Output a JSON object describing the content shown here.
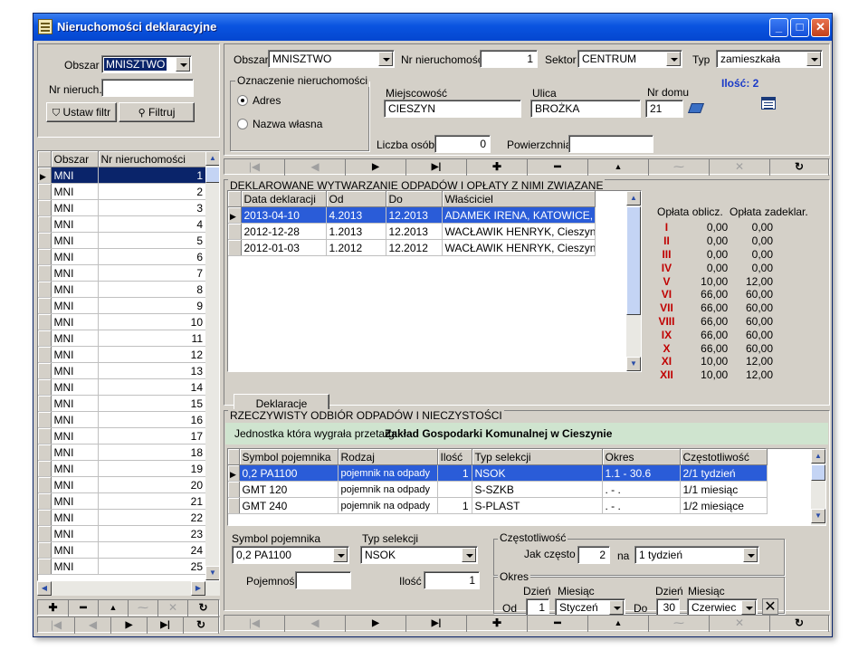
{
  "window": {
    "title": "Nieruchomości deklaracyjne"
  },
  "left": {
    "obszar_label": "Obszar",
    "obszar_value": "MNISZTWO",
    "nr_nieruch_label": "Nr nieruch.",
    "nr_nieruch_value": "",
    "btn_ustaw": "Ustaw filtr",
    "btn_filtruj": "Filtruj",
    "columns": [
      "Obszar",
      "Nr nieruchomości"
    ],
    "rows": [
      [
        "MNI",
        "1"
      ],
      [
        "MNI",
        "2"
      ],
      [
        "MNI",
        "3"
      ],
      [
        "MNI",
        "4"
      ],
      [
        "MNI",
        "5"
      ],
      [
        "MNI",
        "6"
      ],
      [
        "MNI",
        "7"
      ],
      [
        "MNI",
        "8"
      ],
      [
        "MNI",
        "9"
      ],
      [
        "MNI",
        "10"
      ],
      [
        "MNI",
        "11"
      ],
      [
        "MNI",
        "12"
      ],
      [
        "MNI",
        "13"
      ],
      [
        "MNI",
        "14"
      ],
      [
        "MNI",
        "15"
      ],
      [
        "MNI",
        "16"
      ],
      [
        "MNI",
        "17"
      ],
      [
        "MNI",
        "18"
      ],
      [
        "MNI",
        "19"
      ],
      [
        "MNI",
        "20"
      ],
      [
        "MNI",
        "21"
      ],
      [
        "MNI",
        "22"
      ],
      [
        "MNI",
        "23"
      ],
      [
        "MNI",
        "24"
      ],
      [
        "MNI",
        "25"
      ]
    ]
  },
  "header": {
    "obszar_label": "Obszar",
    "obszar_value": "MNISZTWO",
    "nr_label": "Nr nieruchomości",
    "nr_value": "1",
    "sektor_label": "Sektor",
    "sektor_value": "CENTRUM",
    "typ_label": "Typ",
    "typ_value": "zamieszkała",
    "ozn_title": "Oznaczenie nieruchomości",
    "radio_adres": "Adres",
    "radio_nazwa": "Nazwa własna",
    "miejscowosc_label": "Miejscowość",
    "miejscowosc_value": "CIESZYN",
    "ulica_label": "Ulica",
    "ulica_value": "BROŻKA",
    "nrdomu_label": "Nr domu",
    "nrdomu_value": "21",
    "ilosc": "Ilość: 2",
    "liczba_osob_label": "Liczba osób",
    "liczba_osob_value": "0",
    "powierzchnia_label": "Powierzchnia",
    "powierzchnia_value": ""
  },
  "nav_icons": [
    "first",
    "prev",
    "next",
    "last",
    "add",
    "delete",
    "up",
    "edit",
    "cancel",
    "refresh"
  ],
  "declarations": {
    "title": "DEKLAROWANE WYTWARZANIE ODPADÓW I OPŁATY Z NIMI ZWIĄZANE",
    "columns": [
      "Data deklaracji",
      "Od",
      "Do",
      "Właściciel"
    ],
    "rows": [
      [
        "2013-04-10",
        "4.2013",
        "12.2013",
        "ADAMEK IRENA, KATOWICE, ul. B"
      ],
      [
        "2012-12-28",
        "1.2013",
        "12.2013",
        "WACŁAWIK HENRYK, Cieszyn, ul."
      ],
      [
        "2012-01-03",
        "1.2012",
        "12.2012",
        "WACŁAWIK HENRYK, Cieszyn, ul."
      ]
    ],
    "btn_deklaracje": "Deklaracje",
    "fee_col1": "Opłata oblicz.",
    "fee_col2": "Opłata zadeklar.",
    "fees": [
      [
        "I",
        "0,00",
        "0,00"
      ],
      [
        "II",
        "0,00",
        "0,00"
      ],
      [
        "III",
        "0,00",
        "0,00"
      ],
      [
        "IV",
        "0,00",
        "0,00"
      ],
      [
        "V",
        "10,00",
        "12,00"
      ],
      [
        "VI",
        "66,00",
        "60,00"
      ],
      [
        "VII",
        "66,00",
        "60,00"
      ],
      [
        "VIII",
        "66,00",
        "60,00"
      ],
      [
        "IX",
        "66,00",
        "60,00"
      ],
      [
        "X",
        "66,00",
        "60,00"
      ],
      [
        "XI",
        "10,00",
        "12,00"
      ],
      [
        "XII",
        "10,00",
        "12,00"
      ]
    ]
  },
  "collection": {
    "title": "RZECZYWISTY ODBIÓR ODPADÓW I NIECZYSTOŚCI",
    "winner_label": "Jednostka która wygrała przetarg:",
    "winner_value": "Zakład Gospodarki Komunalnej w Cieszynie",
    "columns": [
      "Symbol pojemnika",
      "Rodzaj",
      "Ilość",
      "Typ selekcji",
      "Okres",
      "Częstotliwość"
    ],
    "rows": [
      [
        "0,2 PA1100",
        "pojemnik na odpady",
        "1",
        "NSOK",
        "1.1 - 30.6",
        "2/1 tydzień"
      ],
      [
        "GMT 120",
        "pojemnik na odpady",
        "",
        "S-SZKB",
        ". - .",
        "1/1 miesiąc"
      ],
      [
        "GMT 240",
        "pojemnik na odpady",
        "1",
        "S-PLAST",
        ". - .",
        "1/2 miesiące"
      ]
    ],
    "symbol_label": "Symbol pojemnika",
    "symbol_value": "0,2 PA1100",
    "typsel_label": "Typ selekcji",
    "typsel_value": "NSOK",
    "pojemnosc_label": "Pojemność",
    "pojemnosc_value": "",
    "ilosc_label": "Ilość",
    "ilosc_value": "1",
    "czest_title": "Częstotliwość",
    "jak_czesto_label": "Jak często",
    "jak_czesto_value": "2",
    "na_label": "na",
    "na_value": "1 tydzień",
    "okres_title": "Okres",
    "dzien_label": "Dzień",
    "miesiac_label": "Miesiąc",
    "od_label": "Od",
    "od_dzien": "1",
    "od_miesiac": "Styczeń",
    "do_label": "Do",
    "do_dzien": "30",
    "do_miesiac": "Czerwiec"
  },
  "colors": {
    "title_bar": "#0a54e0",
    "fee_red": "#c00000",
    "winner_bar": "#cfe4cf"
  }
}
